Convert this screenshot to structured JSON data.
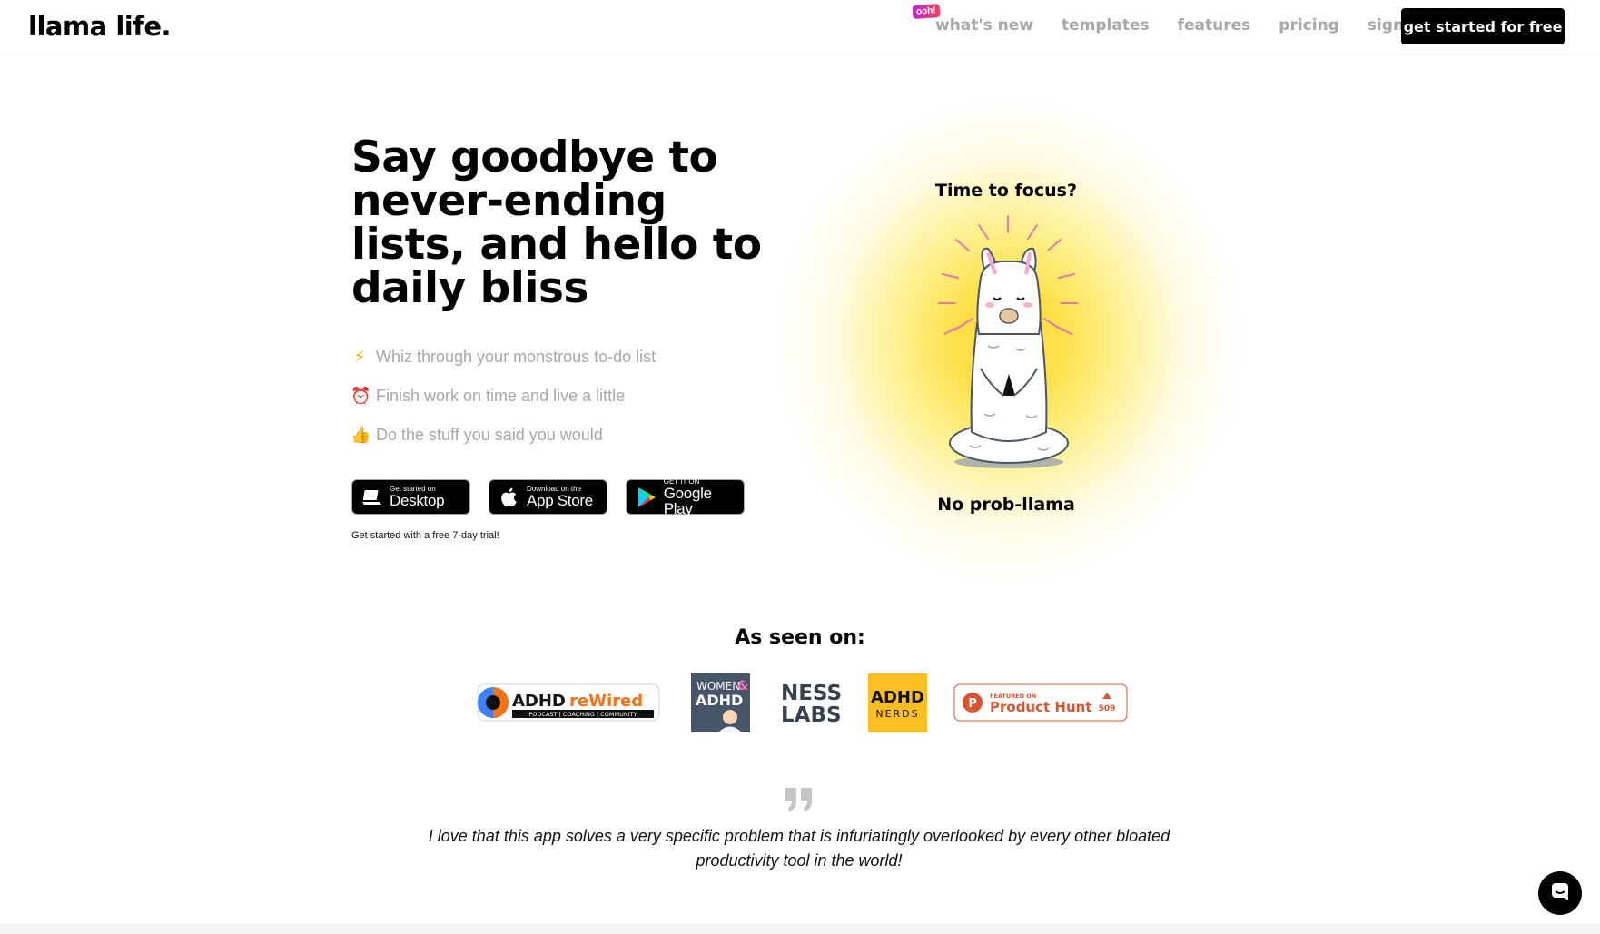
{
  "nav": {
    "logo": "llama life.",
    "badge": "ooh!",
    "links": [
      "what's new",
      "templates",
      "features",
      "pricing",
      "sign in"
    ],
    "cta": "get started for free"
  },
  "hero": {
    "title": "Say goodbye to never-ending lists, and hello to daily bliss",
    "bullets": [
      {
        "emoji": "⚡",
        "text": "Whiz through your monstrous to-do list"
      },
      {
        "emoji": "⏰",
        "text": "Finish work on time and live a little"
      },
      {
        "emoji": "👍",
        "text": "Do the stuff you said you would"
      }
    ],
    "stores": [
      {
        "small": "Get started on",
        "big": "Desktop",
        "icon": "laptop-icon"
      },
      {
        "small": "Download on the",
        "big": "App Store",
        "icon": "apple-icon"
      },
      {
        "small": "GET IT ON",
        "big": "Google Play",
        "icon": "google-play-icon"
      }
    ],
    "trial": "Get started with a free 7-day trial!",
    "illustration": {
      "top_text": "Time to focus?",
      "bottom_text": "No prob-llama"
    }
  },
  "seen_on": {
    "title": "As seen on:",
    "adhd_rewired": {
      "main_a": "ADHD ",
      "main_b": "reWired",
      "sub": "PODCAST | COACHING | COMMUNITY"
    },
    "women_adhd": {
      "line1": "WOMEN",
      "amp": "&",
      "line2": "ADHD"
    },
    "ness_labs": {
      "line1": "NESS",
      "line2": "LABS"
    },
    "adhd_nerds": {
      "line1": "ADHD",
      "line2": "NERDS"
    },
    "product_hunt": {
      "small": "FEATURED ON",
      "big": "Product Hunt",
      "count": "509"
    }
  },
  "testimonial": {
    "text": "I love that this app solves a very specific problem that is infuriatingly overlooked by every other bloated productivity tool in the world!"
  },
  "colors": {
    "accent": "#000000",
    "muted": "#a8a8a8",
    "glow": "#fde047",
    "product_hunt": "#da552f",
    "adhd_orange": "#f97316"
  }
}
